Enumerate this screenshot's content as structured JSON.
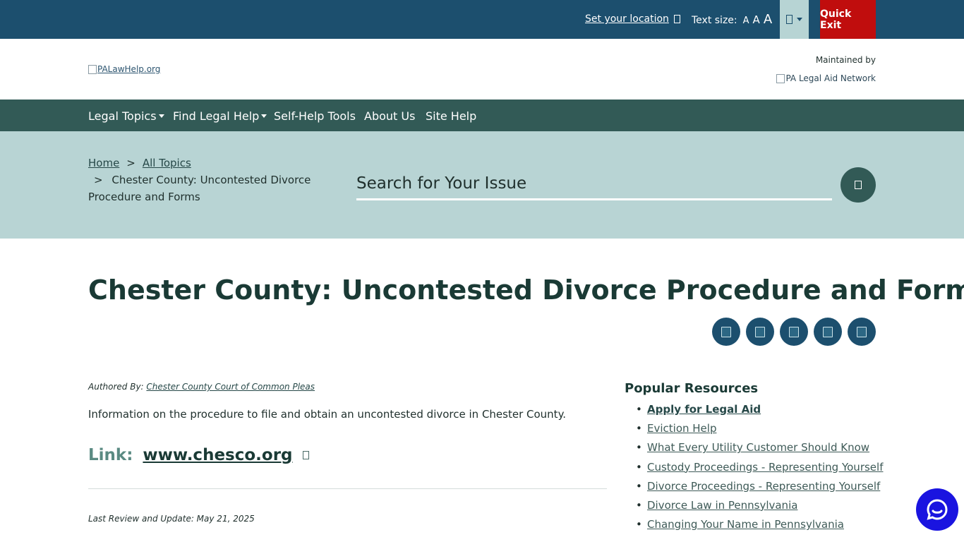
{
  "topbar": {
    "location_link": "Set your location",
    "text_size_label": "Text size:",
    "text_size_options": [
      "A",
      "A",
      "A"
    ],
    "quick_exit": "Quick Exit"
  },
  "header": {
    "logo_alt": "PALawHelp.org",
    "maintained_by": "Maintained by",
    "network_logo_alt": "PA Legal Aid Network"
  },
  "nav": {
    "items": [
      {
        "label": "Legal Topics"
      },
      {
        "label": "Find Legal Help"
      },
      {
        "label": "Self-Help Tools"
      },
      {
        "label": "About Us"
      },
      {
        "label": "Site Help"
      }
    ]
  },
  "breadcrumb": {
    "home": "Home",
    "separator": ">",
    "all_topics": "All Topics",
    "current": "Chester County: Uncontested Divorce Procedure and Forms"
  },
  "search": {
    "label": "Search for Your Issue"
  },
  "page": {
    "title": "Chester County: Uncontested Divorce Procedure and Forms",
    "authored_by_label": "Authored By:",
    "author": "Chester County Court of Common Pleas",
    "description": "Information on the procedure to file and obtain an uncontested divorce in Chester County.",
    "link_label": "Link:",
    "link_url": "www.chesco.org",
    "review": "Last Review and Update: May 21, 2025"
  },
  "sidebar": {
    "heading": "Popular Resources",
    "resources": [
      {
        "label": "Apply for Legal Aid"
      },
      {
        "label": "Eviction Help"
      },
      {
        "label": "What Every Utility Customer Should Know"
      },
      {
        "label": "Custody Proceedings - Representing Yourself"
      },
      {
        "label": "Divorce Proceedings - Representing Yourself"
      },
      {
        "label": "Divorce Law in Pennsylvania"
      },
      {
        "label": "Changing Your Name in Pennsylvania"
      }
    ]
  },
  "colors": {
    "topbar": "#1c4f6e",
    "nav": "#325a56",
    "band": "#b8d4d4",
    "quick_exit": "#c00d0d",
    "chat": "#1a14e0"
  },
  "icons": {
    "location": "location-icon",
    "language": "language-icon",
    "search": "search-icon",
    "share": [
      "facebook-icon",
      "twitter-icon",
      "email-icon",
      "print-icon",
      "share-icon"
    ],
    "external_link": "external-link-icon",
    "chat": "chat-icon"
  }
}
